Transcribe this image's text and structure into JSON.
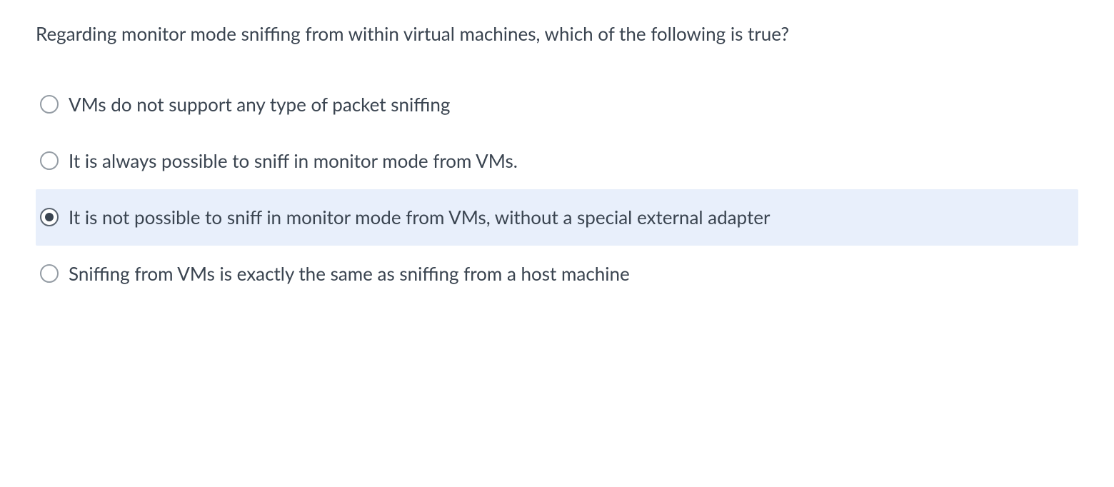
{
  "question": "Regarding monitor mode sniffing from within virtual machines, which of the following is true?",
  "options": [
    {
      "label": "VMs do not support any type of packet sniffing",
      "selected": false
    },
    {
      "label": "It is always possible to sniff in monitor mode from VMs.",
      "selected": false
    },
    {
      "label": "It is not possible to sniff in monitor mode from VMs, without a special external adapter",
      "selected": true
    },
    {
      "label": "Sniffing from VMs is exactly the same as sniffing from a host machine",
      "selected": false
    }
  ]
}
